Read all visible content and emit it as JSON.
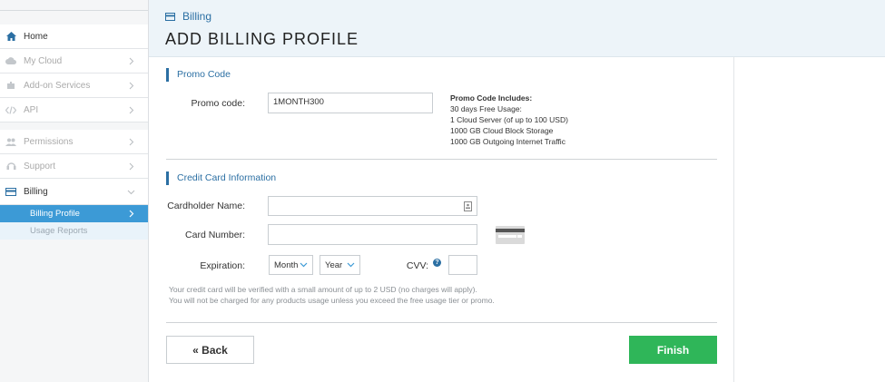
{
  "sidebar": {
    "items": [
      {
        "label": "Home",
        "icon": "home-icon"
      },
      {
        "label": "My Cloud",
        "icon": "cloud-icon"
      },
      {
        "label": "Add-on Services",
        "icon": "puzzle-icon"
      },
      {
        "label": "API",
        "icon": "code-icon"
      },
      {
        "label": "Permissions",
        "icon": "users-icon"
      },
      {
        "label": "Support",
        "icon": "headset-icon"
      },
      {
        "label": "Billing",
        "icon": "card-icon"
      }
    ],
    "sub_items": [
      {
        "label": "Billing Profile"
      },
      {
        "label": "Usage Reports"
      }
    ]
  },
  "header": {
    "breadcrumb": "Billing",
    "title": "ADD BILLING PROFILE"
  },
  "promo": {
    "section_title": "Promo Code",
    "label": "Promo code:",
    "value": "1MONTH300",
    "info_title": "Promo Code Includes:",
    "info_lines": [
      "30 days Free Usage:",
      "1 Cloud Server (of up to 100 USD)",
      "1000 GB Cloud Block Storage",
      "1000 GB Outgoing Internet Traffic"
    ]
  },
  "card": {
    "section_title": "Credit Card Information",
    "name_label": "Cardholder Name:",
    "number_label": "Card Number:",
    "expiration_label": "Expiration:",
    "month": "Month",
    "year": "Year",
    "cvv_label": "CVV:",
    "help": "?",
    "note_lines": [
      "Your credit card will be verified with a small amount of up to 2 USD (no charges will apply).",
      "You will not be charged for any products usage unless you exceed the free usage tier or promo."
    ]
  },
  "actions": {
    "back": "« Back",
    "finish": "Finish"
  },
  "colors": {
    "accent": "#2b6fa3",
    "selected": "#3c9ad6",
    "finish": "#2fb659"
  }
}
